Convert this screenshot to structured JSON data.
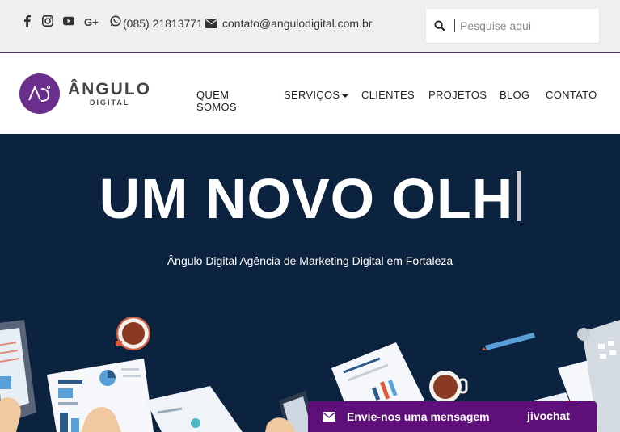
{
  "topbar": {
    "social_icons": [
      "facebook-icon",
      "instagram-icon",
      "youtube-icon",
      "google-plus-icon",
      "whatsapp-icon"
    ],
    "phone": "(085) 21813771",
    "email": "contato@angulodigital.com.br",
    "search_placeholder": "Pesquise aqui"
  },
  "logo": {
    "monogram": "AD",
    "name": "ÂNGULO",
    "tagline": "DIGITAL"
  },
  "nav": {
    "items": [
      "QUEM SOMOS",
      "SERVIÇOS",
      "CLIENTES",
      "PROJETOS",
      "BLOG",
      "CONTATO"
    ]
  },
  "hero": {
    "headline": "UM NOVO OLH",
    "subtitle": "Ângulo Digital Agência de Marketing Digital em Fortaleza"
  },
  "chat": {
    "label": "Envie-nos uma mensagem",
    "brand": "jivochat"
  },
  "colors": {
    "brand_purple": "#6a2e8c",
    "hero_bg": "#0c2340",
    "chat_bg": "#5e0f7a"
  }
}
